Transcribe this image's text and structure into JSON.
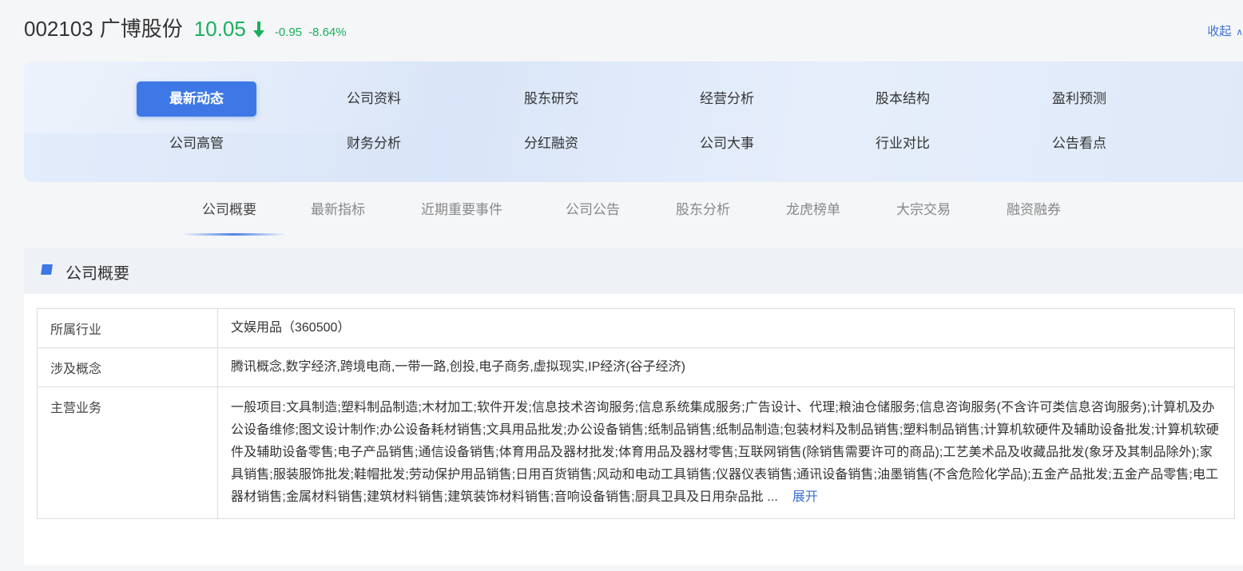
{
  "header": {
    "code": "002103",
    "name": "广博股份",
    "price": "10.05",
    "change": "-0.95",
    "change_pct": "-8.64%",
    "collapse_label": "收起",
    "trend_color": "#18b05c"
  },
  "nav": {
    "row1": [
      "最新动态",
      "公司资料",
      "股东研究",
      "经营分析",
      "股本结构",
      "盈利预测"
    ],
    "row2": [
      "公司高管",
      "财务分析",
      "分红融资",
      "公司大事",
      "行业对比",
      "公告看点"
    ],
    "active": "最新动态",
    "accent": "#3d78e6"
  },
  "subtabs": [
    "公司概要",
    "最新指标",
    "近期重要事件",
    "公司公告",
    "股东分析",
    "龙虎榜单",
    "大宗交易",
    "融资融券"
  ],
  "section": {
    "title": "公司概要"
  },
  "info": {
    "industry_label": "所属行业",
    "industry_value": "文娱用品（360500）",
    "concept_label": "涉及概念",
    "concept_value": "腾讯概念,数字经济,跨境电商,一带一路,创投,电子商务,虚拟现实,IP经济(谷子经济)",
    "business_label": "主营业务",
    "business_value": "一般项目:文具制造;塑料制品制造;木材加工;软件开发;信息技术咨询服务;信息系统集成服务;广告设计、代理;粮油仓储服务;信息咨询服务(不含许可类信息咨询服务);计算机及办公设备维修;图文设计制作;办公设备耗材销售;文具用品批发;办公设备销售;纸制品销售;纸制品制造;包装材料及制品销售;塑料制品销售;计算机软硬件及辅助设备批发;计算机软硬件及辅助设备零售;电子产品销售;通信设备销售;体育用品及器材批发;体育用品及器材零售;互联网销售(除销售需要许可的商品);工艺美术品及收藏品批发(象牙及其制品除外);家具销售;服装服饰批发;鞋帽批发;劳动保护用品销售;日用百货销售;风动和电动工具销售;仪器仪表销售;通讯设备销售;油墨销售(不含危险化学品);五金产品批发;五金产品零售;电工器材销售;金属材料销售;建筑材料销售;建筑装饰材料销售;音响设备销售;厨具卫具及日用杂品批 ...",
    "expand_label": "展开"
  }
}
